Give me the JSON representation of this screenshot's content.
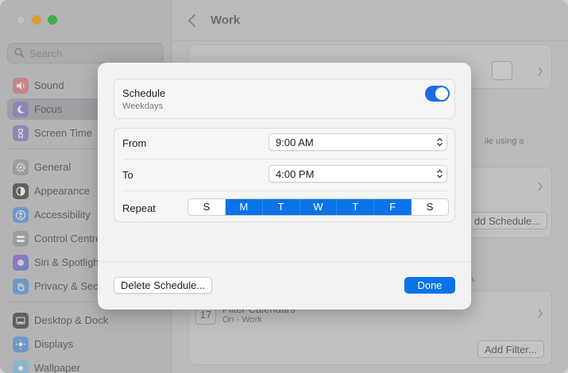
{
  "sidebar": {
    "search_placeholder": "Search",
    "items": [
      {
        "label": "Sound",
        "icon": "speaker-icon",
        "color": "#e8434a"
      },
      {
        "label": "Focus",
        "icon": "moon-icon",
        "color": "#5b55c8",
        "active": true
      },
      {
        "label": "Screen Time",
        "icon": "hourglass-icon",
        "color": "#5b55c8"
      },
      {
        "label": "General",
        "icon": "gear-icon",
        "color": "#8e8e93"
      },
      {
        "label": "Appearance",
        "icon": "appearance-icon",
        "color": "#1c1c1e"
      },
      {
        "label": "Accessibility",
        "icon": "accessibility-icon",
        "color": "#1a7ae6"
      },
      {
        "label": "Control Centre",
        "icon": "control-centre-icon",
        "color": "#8e8e93"
      },
      {
        "label": "Siri & Spotlight",
        "icon": "siri-icon",
        "color": "#7d4fd6"
      },
      {
        "label": "Privacy & Security",
        "icon": "hand-icon",
        "color": "#1a7ae6"
      },
      {
        "label": "Desktop & Dock",
        "icon": "dock-icon",
        "color": "#1c1c1e"
      },
      {
        "label": "Displays",
        "icon": "sun-icon",
        "color": "#1a7ae6"
      },
      {
        "label": "Wallpaper",
        "icon": "wallpaper-icon",
        "color": "#3fb0e8"
      }
    ]
  },
  "content": {
    "title": "Work",
    "hint_text": "ile using a",
    "add_schedule_label": "dd Schedule...",
    "filter_hint": "n.",
    "filter_title": "Filter Calendars",
    "filter_sub": "On - Work",
    "calendar_day": "17",
    "add_filter_label": "Add Filter..."
  },
  "modal": {
    "schedule_title": "Schedule",
    "schedule_sub": "Weekdays",
    "toggle_on": true,
    "from_label": "From",
    "from_value": "9:00 AM",
    "to_label": "To",
    "to_value": "4:00 PM",
    "repeat_label": "Repeat",
    "days": [
      {
        "label": "S",
        "on": false
      },
      {
        "label": "M",
        "on": true
      },
      {
        "label": "T",
        "on": true
      },
      {
        "label": "W",
        "on": true
      },
      {
        "label": "T",
        "on": true
      },
      {
        "label": "F",
        "on": true
      },
      {
        "label": "S",
        "on": false
      }
    ],
    "delete_label": "Delete Schedule...",
    "done_label": "Done"
  },
  "colors": {
    "accent": "#0a73e6"
  }
}
